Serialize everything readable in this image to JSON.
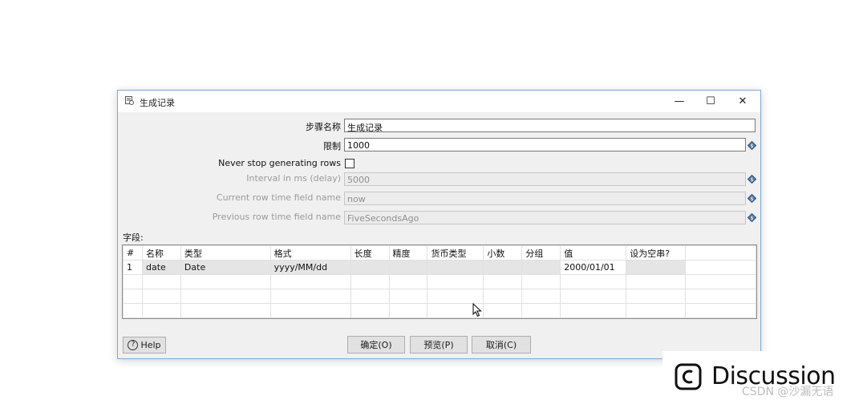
{
  "dialog": {
    "title": "生成记录",
    "window_buttons": {
      "minimize": "—",
      "maximize": "☐",
      "close": "✕"
    }
  },
  "form": {
    "step_name_label": "步骤名称",
    "step_name_value": "生成记录",
    "limit_label": "限制",
    "limit_value": "1000",
    "never_stop_label": "Never stop generating rows",
    "never_stop_checked": false,
    "interval_label": "Interval in ms (delay)",
    "interval_value": "5000",
    "current_row_time_label": "Current row time field name",
    "current_row_time_value": "now",
    "previous_row_time_label": "Previous row time field name",
    "previous_row_time_value": "FiveSecondsAgo"
  },
  "fields": {
    "label": "字段:",
    "columns": [
      "#",
      "名称",
      "类型",
      "格式",
      "长度",
      "精度",
      "货币类型",
      "小数",
      "分组",
      "值",
      "设为空串?"
    ],
    "rows": [
      [
        "1",
        "date",
        "Date",
        "yyyy/MM/dd",
        "",
        "",
        "",
        "",
        "",
        "2000/01/01",
        ""
      ]
    ]
  },
  "buttons": {
    "help": "Help",
    "ok": "确定(O)",
    "preview": "预览(P)",
    "cancel": "取消(C)"
  },
  "overlay": {
    "brand": "Discussion",
    "watermark": "CSDN @沙漏无语"
  }
}
